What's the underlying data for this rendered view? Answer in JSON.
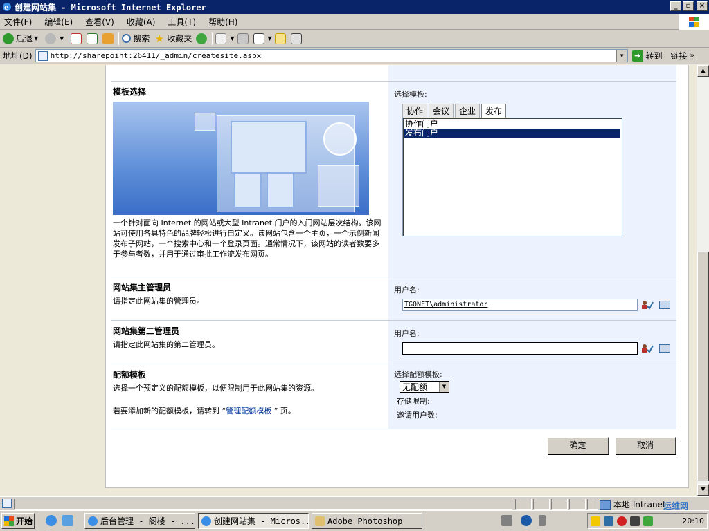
{
  "window": {
    "title": "创建网站集 - Microsoft Internet Explorer",
    "minimize": "_",
    "maximize": "▫",
    "close": "×"
  },
  "menu": [
    "文件(F)",
    "编辑(E)",
    "查看(V)",
    "收藏(A)",
    "工具(T)",
    "帮助(H)"
  ],
  "toolbar": {
    "back": "后退",
    "search": "搜索",
    "favorites": "收藏夹"
  },
  "address": {
    "label": "地址(D)",
    "url": "http://sharepoint:26411/_admin/createsite.aspx",
    "go": "转到",
    "links": "链接"
  },
  "template_section": {
    "title": "模板选择",
    "description": "一个针对面向 Internet 的网站或大型 Intranet 门户的入门网站层次结构。该网站可使用各具特色的品牌轻松进行自定义。该网站包含一个主页，一个示例新闻发布子网站，一个搜索中心和一个登录页面。通常情况下，该网站的读者数要多于参与者数，并用于通过审批工作流发布网页。",
    "select_label": "选择模板:",
    "tabs": [
      "协作",
      "会议",
      "企业",
      "发布"
    ],
    "active_tab": "发布",
    "options": [
      "协作门户",
      "发布门户"
    ],
    "selected_option": "发布门户"
  },
  "primary_admin": {
    "title": "网站集主管理员",
    "description": "请指定此网站集的管理员。",
    "label": "用户名:",
    "value": "TGONET\\administrator"
  },
  "secondary_admin": {
    "title": "网站集第二管理员",
    "description": "请指定此网站集的第二管理员。",
    "label": "用户名:",
    "value": ""
  },
  "quota": {
    "title": "配额模板",
    "description": "选择一个预定义的配额模板，以便限制用于此网站集的资源。",
    "add_prefix": "若要添加新的配额模板，请转到 “",
    "add_link": "管理配额模板",
    "add_suffix": " ” 页。",
    "select_label": "选择配额模板:",
    "selected": "无配额",
    "storage_limit": "存储限制:",
    "invited_users": "邀请用户数:"
  },
  "buttons": {
    "ok": "确定",
    "cancel": "取消"
  },
  "statusbar": {
    "zone": "本地 Intranet"
  },
  "taskbar": {
    "start": "开始",
    "tasks": [
      "后台管理 - 阁楼 - ...",
      "创建网站集 - Micros...",
      "Adobe Photoshop"
    ],
    "clock": "20:10"
  },
  "watermark": "运维网"
}
